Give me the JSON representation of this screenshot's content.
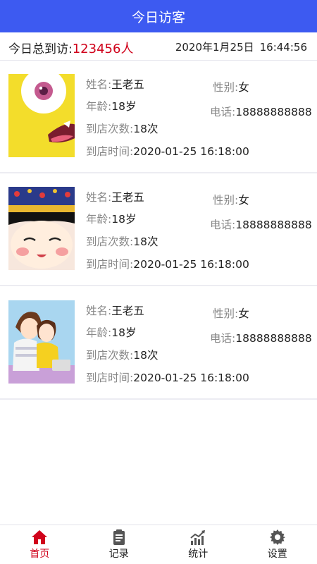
{
  "header": {
    "title": "今日访客"
  },
  "summary": {
    "label": "今日总到访:",
    "count": "123456人",
    "date": "2020年1月25日",
    "time": "16:44:56"
  },
  "visitors": [
    {
      "name_label": "姓名:",
      "name": "王老五",
      "gender_label": "性别:",
      "gender": "女",
      "age_label": "年龄:",
      "age": "18岁",
      "phone_label": "电话:",
      "phone": "18888888888",
      "visits_label": "到店次数:",
      "visits": "18次",
      "time_label": "到店时间:",
      "time": "2020-01-25 16:18:00",
      "avatar_icon": "yellow-cartoon-monster-avatar"
    },
    {
      "name_label": "姓名:",
      "name": "王老五",
      "gender_label": "性别:",
      "gender": "女",
      "age_label": "年龄:",
      "age": "18岁",
      "phone_label": "电话:",
      "phone": "18888888888",
      "visits_label": "到店次数:",
      "visits": "18次",
      "time_label": "到店时间:",
      "time": "2020-01-25 16:18:00",
      "avatar_icon": "cartoon-girl-headdress-avatar"
    },
    {
      "name_label": "姓名:",
      "name": "王老五",
      "gender_label": "性别:",
      "gender": "女",
      "age_label": "年龄:",
      "age": "18岁",
      "phone_label": "电话:",
      "phone": "18888888888",
      "visits_label": "到店次数:",
      "visits": "18次",
      "time_label": "到店时间:",
      "time": "2020-01-25 16:18:00",
      "avatar_icon": "cartoon-couple-avatar"
    }
  ],
  "tabbar": {
    "tabs": [
      {
        "label": "首页",
        "icon": "home-icon",
        "active": true
      },
      {
        "label": "记录",
        "icon": "clipboard-icon",
        "active": false
      },
      {
        "label": "统计",
        "icon": "chart-icon",
        "active": false
      },
      {
        "label": "设置",
        "icon": "gear-icon",
        "active": false
      }
    ]
  },
  "colors": {
    "header_bg": "#3d5af1",
    "accent_red": "#d0021b",
    "label_gray": "#888888"
  }
}
